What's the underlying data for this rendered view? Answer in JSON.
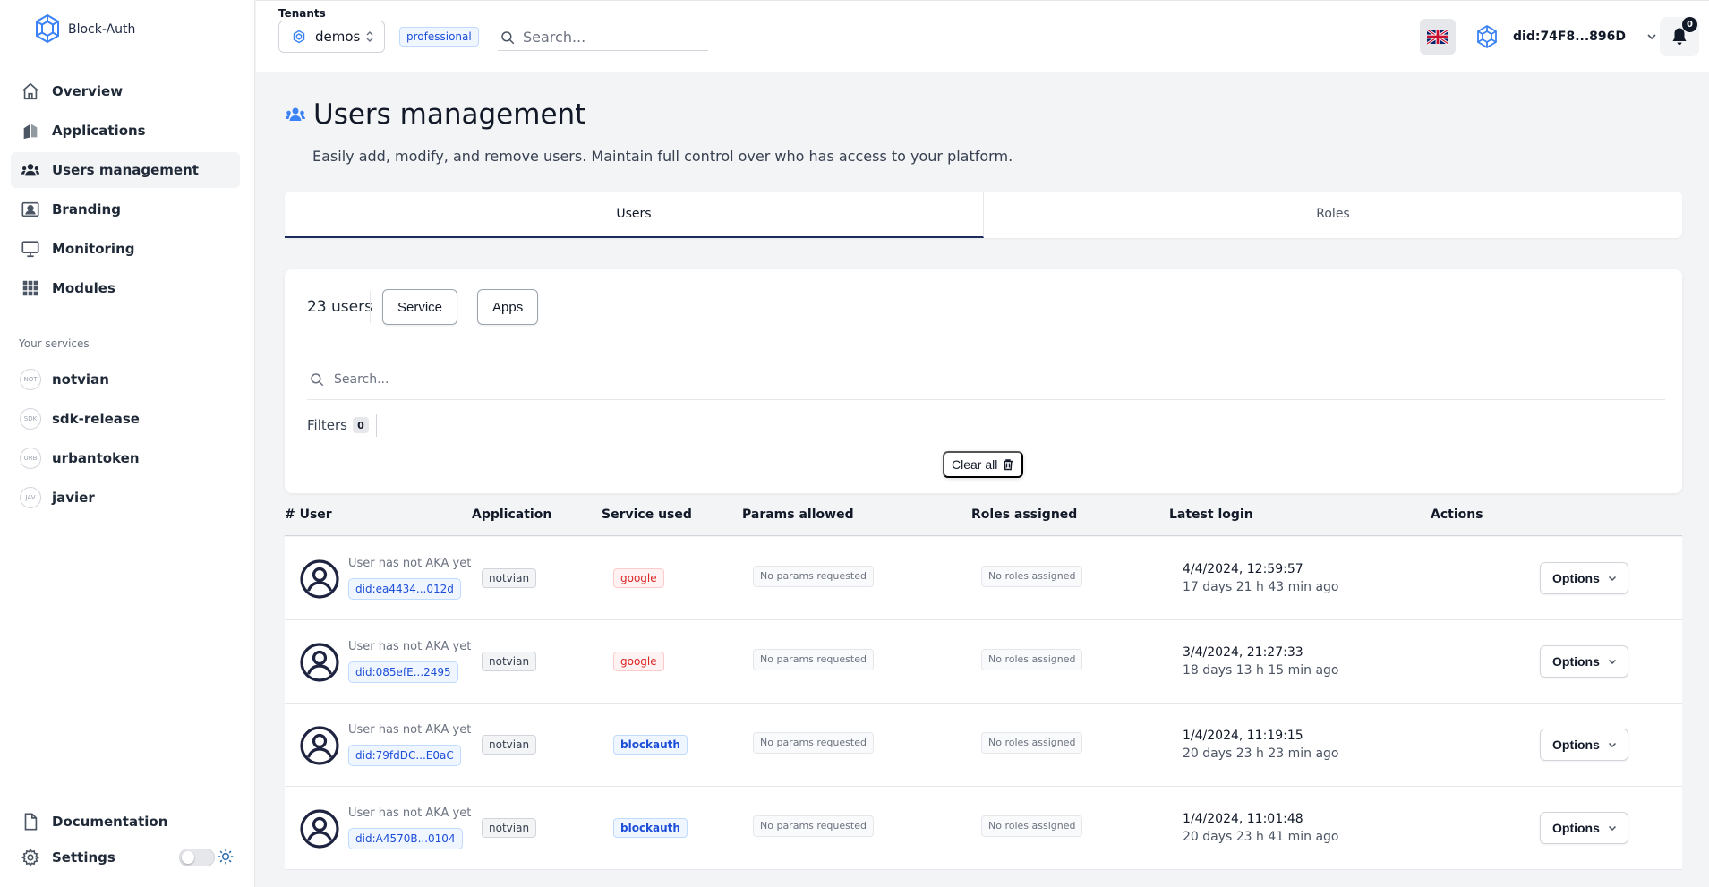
{
  "app": {
    "name": "Block-Auth"
  },
  "sidebar": {
    "items": [
      {
        "label": "Overview",
        "icon": "home-icon",
        "active": false
      },
      {
        "label": "Applications",
        "icon": "applications-icon",
        "active": false
      },
      {
        "label": "Users management",
        "icon": "users-icon",
        "active": true
      },
      {
        "label": "Branding",
        "icon": "branding-icon",
        "active": false
      },
      {
        "label": "Monitoring",
        "icon": "monitor-icon",
        "active": false
      },
      {
        "label": "Modules",
        "icon": "grid-icon",
        "active": false
      }
    ],
    "services_title": "Your services",
    "services": [
      {
        "abbr": "NOT",
        "label": "notvian"
      },
      {
        "abbr": "SDK",
        "label": "sdk-release"
      },
      {
        "abbr": "URB",
        "label": "urbantoken"
      },
      {
        "abbr": "JAV",
        "label": "javier"
      }
    ],
    "documentation_label": "Documentation",
    "settings_label": "Settings"
  },
  "topbar": {
    "tenants_label": "Tenants",
    "tenant": "demos",
    "plan": "professional",
    "search_placeholder": "Search...",
    "account_did": "did:74F8...896D",
    "notifications_count": "0"
  },
  "page": {
    "title": "Users management",
    "subtitle": "Easily add, modify, and remove users. Maintain full control over who has access to your platform.",
    "tabs": [
      "Users",
      "Roles"
    ],
    "active_tab": "Users"
  },
  "filters": {
    "users_count": "23 users",
    "service_label": "Service",
    "apps_label": "Apps",
    "search_placeholder": "Search...",
    "filters_label": "Filters",
    "filters_count": "0",
    "clear_all_label": "Clear all"
  },
  "table": {
    "headers": [
      "# User",
      "Application",
      "Service used",
      "Params allowed",
      "Roles assigned",
      "Latest login",
      "Actions"
    ],
    "rows": [
      {
        "aka": "User has not AKA yet",
        "did": "did:ea4434...012d",
        "application": "notvian",
        "service": "google",
        "params": "No params requested",
        "roles": "No roles assigned",
        "login_date": "4/4/2024, 12:59:57",
        "login_ago": "17 days 21 h 43 min ago",
        "action": "Options"
      },
      {
        "aka": "User has not AKA yet",
        "did": "did:085efE...2495",
        "application": "notvian",
        "service": "google",
        "params": "No params requested",
        "roles": "No roles assigned",
        "login_date": "3/4/2024, 21:27:33",
        "login_ago": "18 days 13 h 15 min ago",
        "action": "Options"
      },
      {
        "aka": "User has not AKA yet",
        "did": "did:79fdDC...E0aC",
        "application": "notvian",
        "service": "blockauth",
        "params": "No params requested",
        "roles": "No roles assigned",
        "login_date": "1/4/2024, 11:19:15",
        "login_ago": "20 days 23 h 23 min ago",
        "action": "Options"
      },
      {
        "aka": "User has not AKA yet",
        "did": "did:A4570B...0104",
        "application": "notvian",
        "service": "blockauth",
        "params": "No params requested",
        "roles": "No roles assigned",
        "login_date": "1/4/2024, 11:01:48",
        "login_ago": "20 days 23 h 41 min ago",
        "action": "Options"
      }
    ]
  },
  "colors": {
    "accent": "#3b82f6",
    "active_tab_underline": "#1e2a5a",
    "google_service": "#dc2626",
    "blockauth_service": "#1d4ed8"
  }
}
